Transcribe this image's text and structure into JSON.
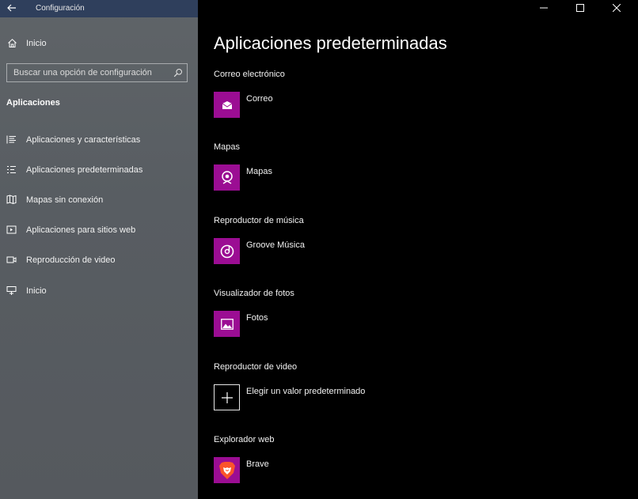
{
  "window": {
    "app_title": "Configuración"
  },
  "sidebar": {
    "home_label": "Inicio",
    "search_placeholder": "Buscar una opción de configuración",
    "section_title": "Aplicaciones",
    "items": [
      {
        "label": "Aplicaciones y características",
        "icon": "list-icon"
      },
      {
        "label": "Aplicaciones predeterminadas",
        "icon": "default-apps-icon"
      },
      {
        "label": "Mapas sin conexión",
        "icon": "map-icon"
      },
      {
        "label": "Aplicaciones para sitios web",
        "icon": "website-apps-icon"
      },
      {
        "label": "Reproducción de video",
        "icon": "video-icon"
      },
      {
        "label": "Inicio",
        "icon": "startup-icon"
      }
    ]
  },
  "main": {
    "title": "Aplicaciones predeterminadas",
    "categories": [
      {
        "label": "Correo electrónico",
        "app": "Correo",
        "icon": "mail-icon"
      },
      {
        "label": "Mapas",
        "app": "Mapas",
        "icon": "maps-app-icon"
      },
      {
        "label": "Reproductor de música",
        "app": "Groove Música",
        "icon": "groove-icon"
      },
      {
        "label": "Visualizador de fotos",
        "app": "Fotos",
        "icon": "photos-icon"
      },
      {
        "label": "Reproductor de video",
        "app": "Elegir un valor predeterminado",
        "icon": "plus-icon"
      },
      {
        "label": "Explorador web",
        "app": "Brave",
        "icon": "brave-icon"
      }
    ]
  },
  "colors": {
    "accent": "#9b0d93",
    "sidebar_bg": "#5b6064",
    "titlebar": "#2f3f5c",
    "main_bg": "#000000"
  }
}
